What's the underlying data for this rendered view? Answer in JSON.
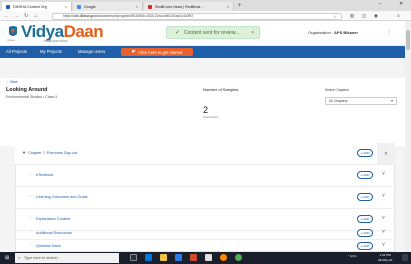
{
  "browser": {
    "tabs": [
      {
        "label": "DIKSHA Content Org",
        "favicon_color": "#1f5faa",
        "active": true
      },
      {
        "label": "Google",
        "favicon_color": "#4285f4",
        "active": false
      },
      {
        "label": "Rediff.com News | Rediffmai...",
        "favicon_color": "#d32f2f",
        "active": false
      }
    ],
    "url_host": "vdn.diksha.gov.in",
    "url_path": "/workbench/program/5f1159d0-4024-11ea-bd60-67ad014c0f57",
    "url_prefix": "https://",
    "new_tab": "+",
    "win_minimize": "–",
    "win_close": "✕"
  },
  "header": {
    "logo_vidya": "Vidya",
    "logo_daan": "Daan",
    "logo_tagline": "SHARE FOR NATION",
    "logo_small": "DIKSHA",
    "toast_text": "Content sent for review...",
    "toast_close": "×",
    "org_label": "Organisation :",
    "org_value": "APS Bikaner"
  },
  "nav": {
    "items": [
      "All Projects",
      "My Projects",
      "Manage Users"
    ],
    "cta": "Click here to get started"
  },
  "page": {
    "back": "← Back",
    "title": "Looking Around",
    "subtitle": "Environmental Studies  •  Class 5",
    "num_samples_label": "Number of Samples",
    "num_samples_value": "2",
    "num_samples_caption": "Total Content",
    "chapters_label": "Select Chapters",
    "chapters_value": "All Chapters"
  },
  "chapter": {
    "title": "Chapter 7: Pomones Day out",
    "add_label": "ADD",
    "sections": [
      "eTextbook",
      "Learning Outcomes and Goals",
      "Explanation Content",
      "Additional Resources",
      "Question Bank"
    ]
  },
  "taskbar": {
    "search_placeholder": "Type here to search",
    "tray": "^ ENG",
    "time": "1:31 PM",
    "date": "28-May-20"
  },
  "colors": {
    "brand_blue": "#1f5faa",
    "brand_orange": "#e8602c",
    "toast_green": "#dff0d8"
  }
}
